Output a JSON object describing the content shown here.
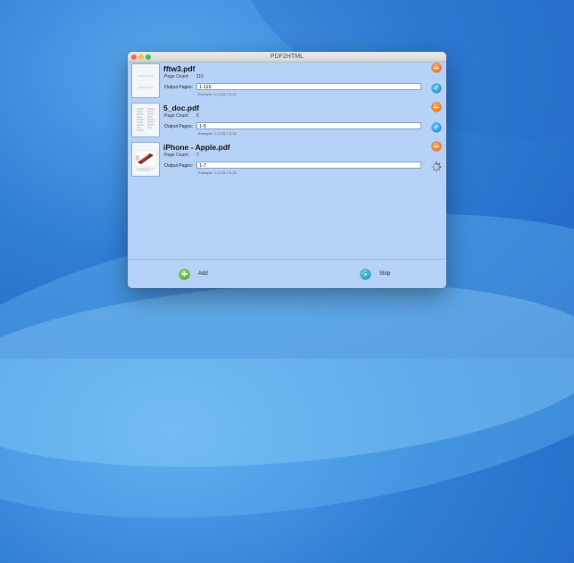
{
  "window": {
    "title": "PDF2HTML"
  },
  "files": [
    {
      "name": "fftw3.pdf",
      "page_count_label": "Page Count:",
      "page_count": "116",
      "output_label": "Output Pages:",
      "output_value": "1-116",
      "example": "Example: 1,2,3,5-7,9-15",
      "status": "done",
      "thumbnail": "document-thumbnail"
    },
    {
      "name": "5_doc.pdf",
      "page_count_label": "Page Count:",
      "page_count": "5",
      "output_label": "Output Pages:",
      "output_value": "1-5",
      "example": "Example: 1,2,3,5-7,9-15",
      "status": "done",
      "thumbnail": "text-document-thumbnail"
    },
    {
      "name": "iPhone - Apple.pdf",
      "page_count_label": "Page Count:",
      "page_count": "7",
      "output_label": "Output Pages:",
      "output_value": "1-7",
      "example": "Example: 1,2,3,5-7,9-15",
      "status": "processing",
      "thumbnail": "image-document-thumbnail"
    }
  ],
  "footer": {
    "add_label": "Add",
    "stop_label": "Stop"
  },
  "icons": {
    "remove": "minus-circle-icon",
    "done": "checkmark-circle-icon",
    "processing": "spinner-icon",
    "add": "plus-circle-icon",
    "stop": "stop-circle-icon"
  },
  "colors": {
    "window_bg": "#b6d2f6",
    "remove": "#f07a1b",
    "done": "#1f9be0",
    "add": "#4fb521",
    "stop": "#1aa3c8"
  }
}
